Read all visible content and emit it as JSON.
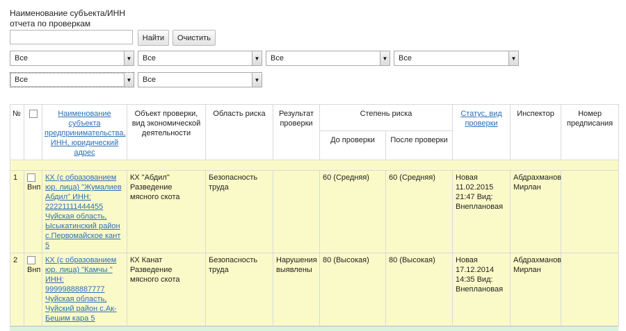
{
  "search": {
    "label_line1": "Наименование субъекта/ИНН",
    "label_line2": "отчета по проверкам",
    "input_value": "",
    "find_button": "Найти",
    "clear_button": "Очистить"
  },
  "filters": {
    "row1": [
      "Все",
      "Все",
      "Все",
      "Все"
    ],
    "row2": [
      "Все",
      "Все"
    ]
  },
  "table": {
    "headers": {
      "num": "№",
      "subject": "Наименование субъекта предпринимательства, ИНН, юридический адрес",
      "object": "Объект проверки, вид экономической деятельности",
      "risk_area": "Область риска",
      "result": "Результат проверки",
      "risk_degree": "Степень риска",
      "before": "До проверки",
      "after": "После проверки",
      "status": "Статус, вид проверки",
      "inspector": "Инспектор",
      "order_number": "Номер предписания"
    },
    "rows": [
      {
        "num": "1",
        "vnp": "Внп",
        "subject_link": "КХ (с образованием юр. лица) \"Жумалиев Абдил\" ИНН: 22221111444455 Чуйская область, Ысыкатинский район с.Первомайское кант 5",
        "object": "КХ \"Абдил\" Разведение мясного скота",
        "risk_area": "Безопасность труда",
        "result": "",
        "before": "60 (Средняя)",
        "after": "60 (Средняя)",
        "status": "Новая 11.02.2015 21:47 Вид: Внеплановая",
        "inspector": "Абдрахманов Мирлан",
        "order_number": ""
      },
      {
        "num": "2",
        "vnp": "Внп",
        "subject_link": "КХ (с образованием юр. лица) \"Камчы \" ИНН: 99999888887777 Чуйская область, Чуйский район с.Ак-Бешим кара 5",
        "object": "КХ Канат Разведение мясного скота",
        "risk_area": "Безопасность труда",
        "result": "Нарушения выявлены",
        "before": "80 (Высокая)",
        "after": "80 (Высокая)",
        "status": "Новая 17.12.2014 14:35 Вид: Внеплановая",
        "inspector": "Абдрахманов Мирлан",
        "order_number": ""
      }
    ]
  }
}
